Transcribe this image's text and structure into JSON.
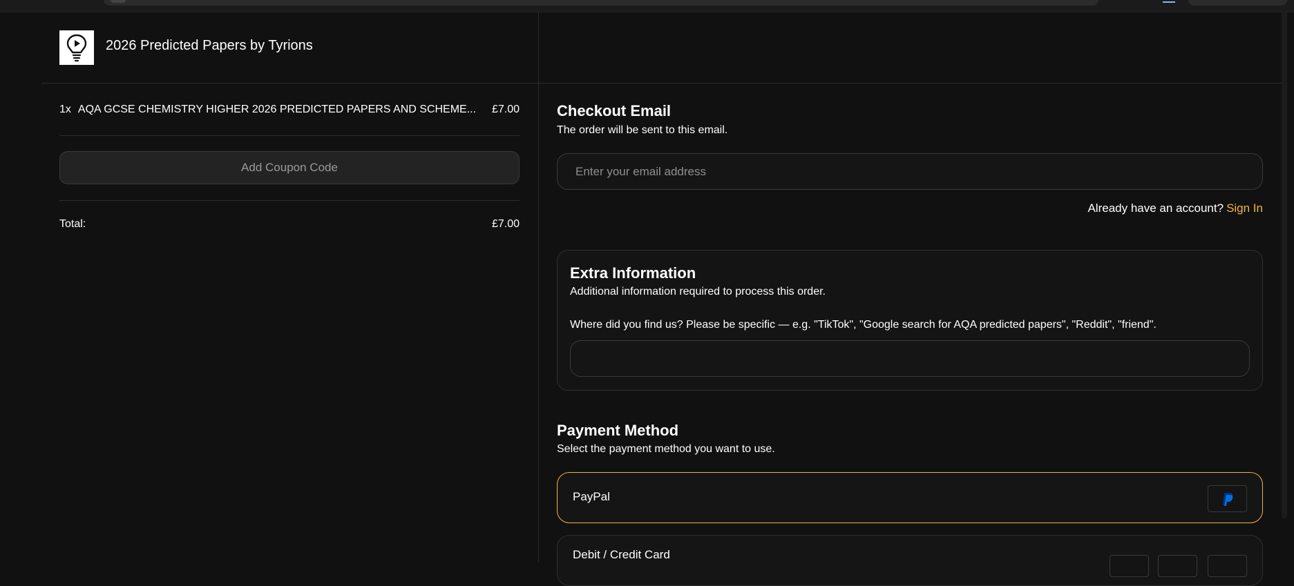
{
  "store": {
    "title": "2026 Predicted Papers by Tyrions",
    "logo_icon": "lightbulb-play-icon"
  },
  "cart": {
    "items": [
      {
        "qty": "1x",
        "name": "AQA GCSE CHEMISTRY HIGHER 2026 PREDICTED PAPERS AND SCHEME...",
        "price": "£7.00"
      }
    ],
    "coupon_label": "Add Coupon Code",
    "total_label": "Total:",
    "total_value": "£7.00"
  },
  "checkout_email": {
    "title": "Checkout Email",
    "subtitle": "The order will be sent to this email.",
    "placeholder": "Enter your email address",
    "account_prompt": "Already have an account?",
    "signin_label": "Sign In"
  },
  "extra_info": {
    "title": "Extra Information",
    "subtitle": "Additional information required to process this order.",
    "question": "Where did you find us? Please be specific — e.g. \"TikTok\", \"Google search for AQA predicted papers\", \"Reddit\", \"friend\".",
    "value": ""
  },
  "payment": {
    "title": "Payment Method",
    "subtitle": "Select the payment method you want to use.",
    "options": [
      {
        "label": "PayPal",
        "selected": true,
        "icon": "paypal-icon"
      },
      {
        "label": "Debit / Credit Card",
        "selected": false,
        "icon": "card-icons"
      }
    ]
  },
  "colors": {
    "background": "#111111",
    "accent": "#f2b544",
    "paypal_blue": "#0070e0"
  }
}
